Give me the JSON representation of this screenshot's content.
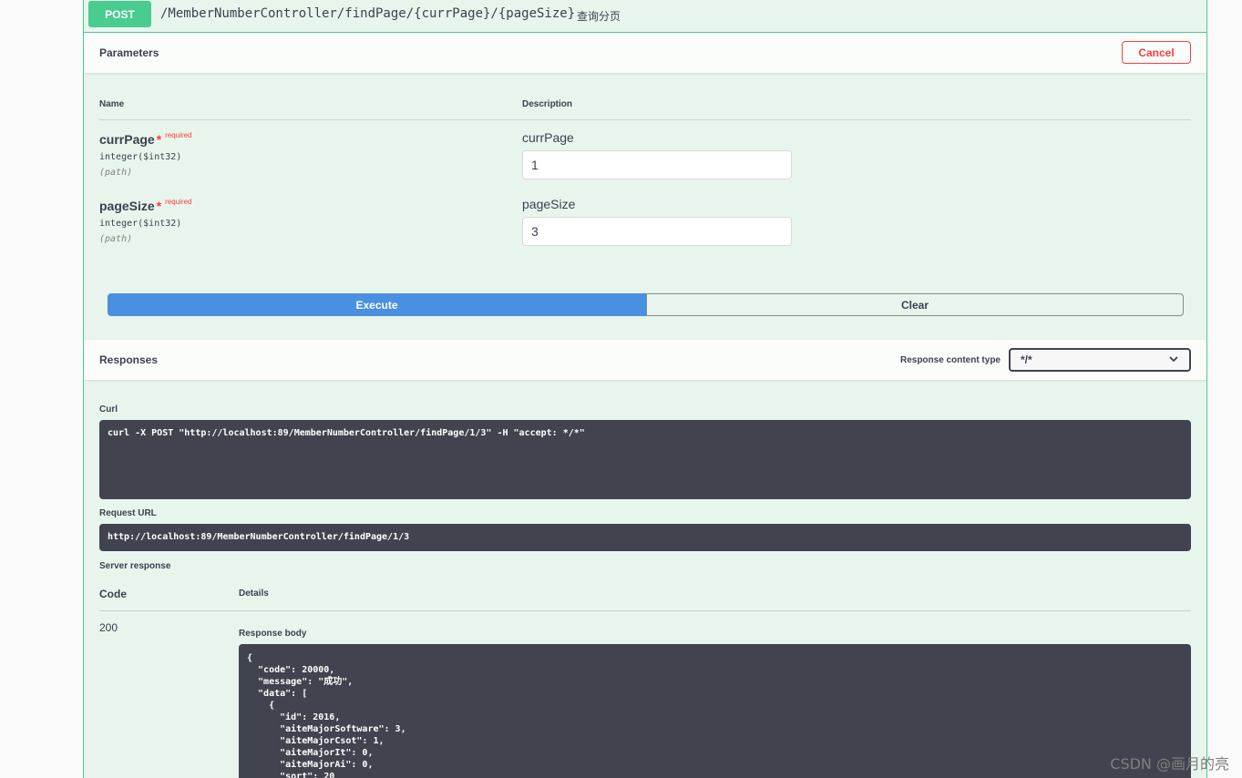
{
  "summary": {
    "method": "POST",
    "path": "/MemberNumberController/findPage/{currPage}/{pageSize}",
    "description": "查询分页"
  },
  "parameters": {
    "title": "Parameters",
    "cancel_label": "Cancel",
    "col_name": "Name",
    "col_description": "Description",
    "items": [
      {
        "name": "currPage",
        "star": "*",
        "required": "required",
        "type": "integer($int32)",
        "in": "(path)",
        "label": "currPage",
        "value": "1"
      },
      {
        "name": "pageSize",
        "star": "*",
        "required": "required",
        "type": "integer($int32)",
        "in": "(path)",
        "label": "pageSize",
        "value": "3"
      }
    ],
    "execute_label": "Execute",
    "clear_label": "Clear"
  },
  "responses": {
    "title": "Responses",
    "content_type_label": "Response content type",
    "content_type_value": "*/*",
    "curl_label": "Curl",
    "curl": "curl -X POST \"http://localhost:89/MemberNumberController/findPage/1/3\" -H \"accept: */*\"",
    "request_url_label": "Request URL",
    "request_url": "http://localhost:89/MemberNumberController/findPage/1/3",
    "server_response_label": "Server response",
    "col_code": "Code",
    "col_details": "Details",
    "code": "200",
    "response_body_label": "Response body",
    "response_body": "{\n  \"code\": 20000,\n  \"message\": \"成功\",\n  \"data\": [\n    {\n      \"id\": 2016,\n      \"aiteMajorSoftware\": 3,\n      \"aiteMajorCsot\": 1,\n      \"aiteMajorIt\": 0,\n      \"aiteMajorAi\": 0,\n      \"sort\": 20"
  },
  "watermark": "CSDN @画月的亮",
  "colors": {
    "post": "#49cc90",
    "execute": "#4990e2",
    "cancel": "#f93e3e",
    "code_bg": "#41444e"
  }
}
